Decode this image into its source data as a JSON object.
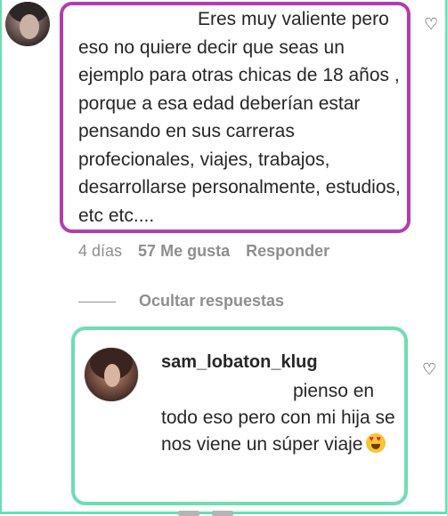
{
  "top_comment": {
    "text": "Eres muy valiente pero eso no quiere decir que seas un ejemplo para otras chicas de 18 años , porque a esa edad deberían estar pensando en sus carreras profecionales, viajes, trabajos, desarrollarse personalmente, estudios, etc etc....",
    "highlight_color": "#b33cae",
    "meta": {
      "age": "4 días",
      "likes": "57 Me gusta",
      "reply": "Responder"
    }
  },
  "hide_replies": {
    "label": "Ocultar respuestas"
  },
  "reply_comment": {
    "username": "sam_lobaton_klug",
    "text": "pienso en todo eso pero con mi hija se nos viene un súper viaje",
    "emoji": "star-struck-emoji",
    "highlight_color": "#6fdcb4"
  },
  "icons": {
    "like_top": "heart-outline-icon",
    "like_reply": "heart-outline-icon"
  }
}
